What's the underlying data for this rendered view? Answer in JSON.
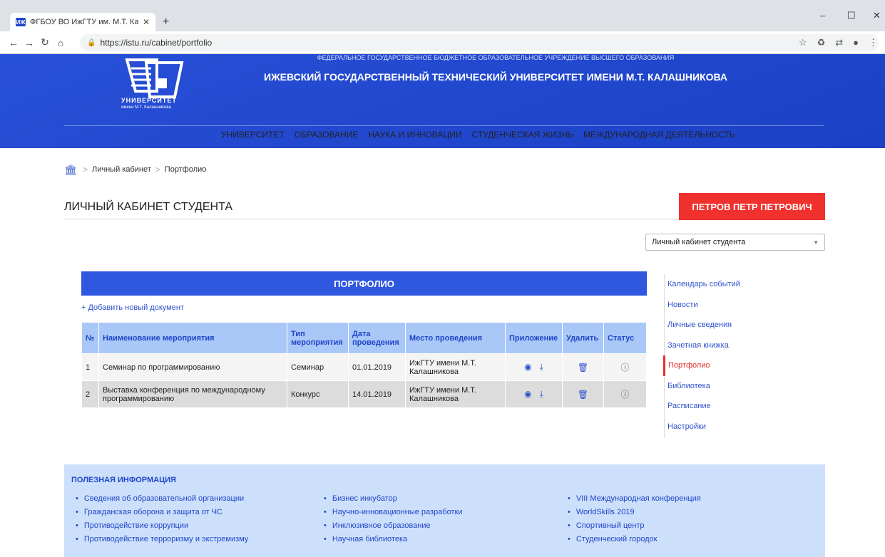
{
  "browser": {
    "tab_title": "ФГБОУ ВО ИжГТУ им. М.Т. Калаш",
    "favicon_text": "ИЖ",
    "url": "https://istu.ru/cabinet/portfolio"
  },
  "header": {
    "top_line": "ФЕДЕРАЛЬНОЕ ГОСУДАРСТВЕННОЕ БЮДЖЕТНОЕ ОБРАЗОВАТЕЛЬНОЕ УЧРЕЖДЕНИЕ ВЫСШЕГО ОБРАЗОВАНИЯ",
    "university_name": "ИЖЕВСКИЙ ГОСУДАРСТВЕННЫЙ ТЕХНИЧЕСКИЙ УНИВЕРСИТЕТ ИМЕНИ М.Т. КАЛАШНИКОВА",
    "logo_line1": "УНИВЕРСИТЕТ",
    "logo_line2": "имени М.Т. Калашникова",
    "nav": [
      "УНИВЕРСИТЕТ",
      "ОБРАЗОВАНИЕ",
      "НАУКА И ИННОВАЦИИ",
      "СТУДЕНЧЕСКАЯ ЖИЗНЬ",
      "МЕЖДУНАРОДНАЯ ДЕЯТЕЛЬНОСТЬ"
    ]
  },
  "breadcrumb": {
    "item1": "Личный кабинет",
    "item2": "Портфолио"
  },
  "page": {
    "title": "ЛИЧНЫЙ КАБИНЕТ СТУДЕНТА",
    "user_button": "ПЕТРОВ ПЕТР ПЕТРОВИЧ",
    "select_value": "Личный кабинет студента"
  },
  "portfolio": {
    "heading": "ПОРТФОЛИО",
    "add_link": "+ Добавить новый документ",
    "columns": [
      "№",
      "Наименование мероприятия",
      "Тип мероприятия",
      "Дата проведения",
      "Место проведения",
      "Приложение",
      "Удалить",
      "Статус"
    ],
    "rows": [
      {
        "num": "1",
        "name": "Семинар по программированию",
        "type": "Семинар",
        "date": "01.01.2019",
        "place": "ИжГТУ имени М.Т. Калашникова"
      },
      {
        "num": "2",
        "name": "Выставка конференция по международному программированию",
        "type": "Конкурс",
        "date": "14.01.2019",
        "place": "ИжГТУ имени М.Т. Калашникова"
      }
    ]
  },
  "sidenav": [
    "Календарь событий",
    "Новости",
    "Личные сведения",
    "Зачетная книжка",
    "Портфолио",
    "Библиотека",
    "Расписание",
    "Настройки"
  ],
  "info": {
    "title": "ПОЛЕЗНАЯ ИНФОРМАЦИЯ",
    "col1": [
      "Сведения об образовательной организации",
      "Гражданская оборона и защита от ЧС",
      "Противодействие коррупции",
      "Противодействие терроризму и экстремизму"
    ],
    "col2": [
      "Бизнес инкубатор",
      "Научно-инновационные разработки",
      "Инклюзивное образование",
      "Научная библиотека"
    ],
    "col3": [
      "VIII Международная конференция",
      "WorldSkills 2019",
      "Спортивный центр",
      "Студенческий городок"
    ]
  },
  "colors": {
    "brand_blue": "#1d46d6",
    "accent_red": "#f0312d",
    "table_header": "#a9c7f7"
  }
}
